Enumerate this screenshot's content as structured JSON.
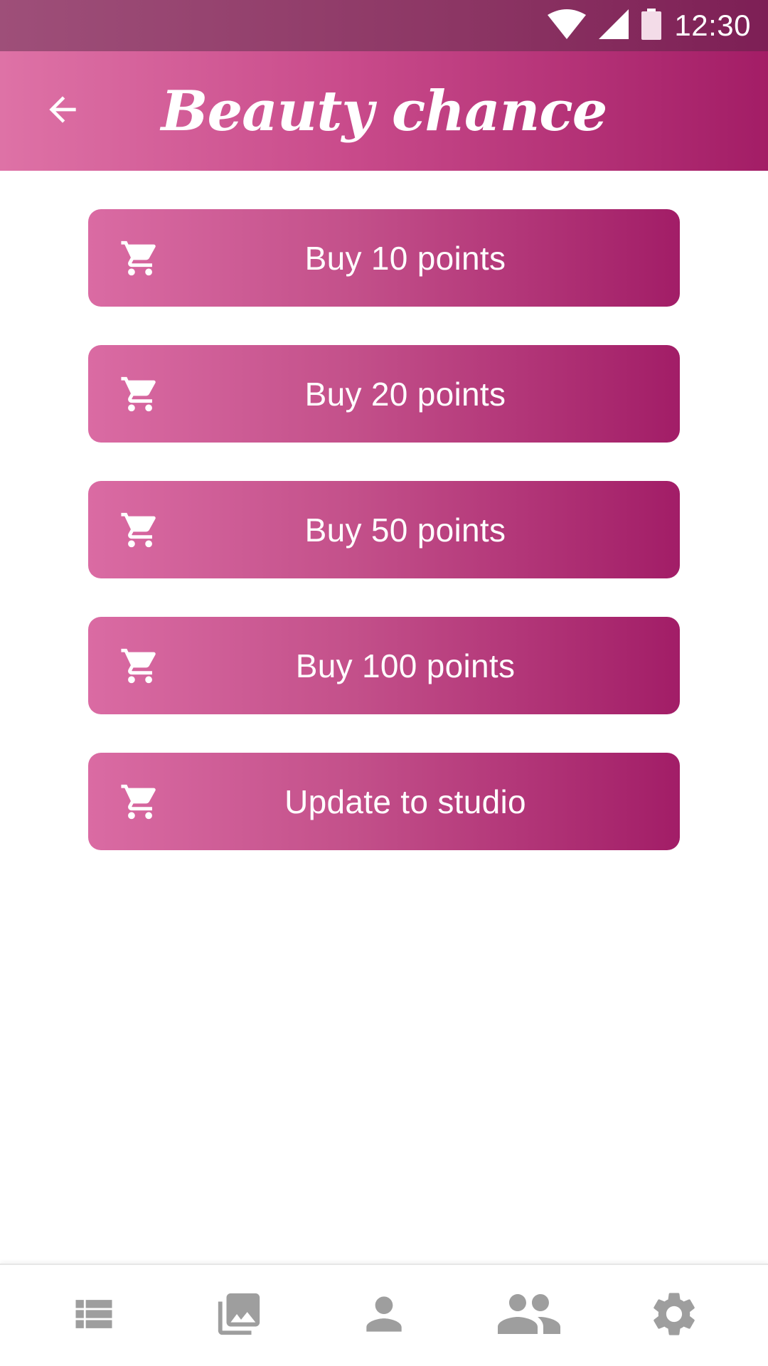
{
  "status_bar": {
    "time": "12:30",
    "icons": [
      "wifi-icon",
      "cell-signal-icon",
      "battery-icon"
    ]
  },
  "app_bar": {
    "title": "Beauty chance",
    "back_icon": "arrow-back-icon"
  },
  "buy_options": [
    {
      "label": "Buy 10 points",
      "icon": "cart-icon"
    },
    {
      "label": "Buy 20 points",
      "icon": "cart-icon"
    },
    {
      "label": "Buy 50 points",
      "icon": "cart-icon"
    },
    {
      "label": "Buy 100 points",
      "icon": "cart-icon"
    },
    {
      "label": "Update to studio",
      "icon": "cart-icon"
    }
  ],
  "bottom_nav": {
    "items": [
      "list-icon",
      "photo-library-icon",
      "person-icon",
      "people-icon",
      "settings-icon"
    ]
  },
  "colors": {
    "gradient_start": "#de72a6",
    "gradient_end": "#a31d66",
    "status_bar": "#8c3664",
    "nav_icon": "#9e9e9e"
  }
}
